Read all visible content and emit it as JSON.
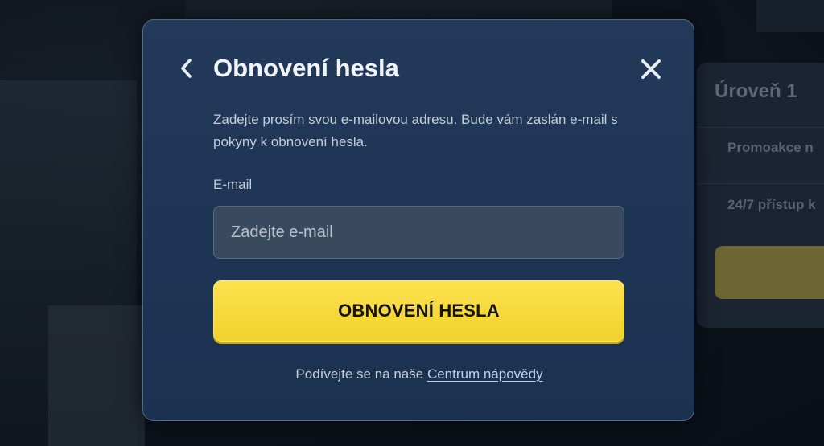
{
  "modal": {
    "title": "Obnovení hesla",
    "description": "Zadejte prosím svou e-mailovou adresu. Bude vám zaslán e-mail s pokyny k obnovení hesla.",
    "email_label": "E-mail",
    "email_placeholder": "Zadejte e-mail",
    "email_value": "",
    "submit_label": "OBNOVENÍ HESLA",
    "help_prefix": "Podívejte se na naše",
    "help_link": "Centrum nápovědy",
    "back_icon": "chevron-left-icon",
    "close_icon": "close-icon"
  },
  "background_card": {
    "title": "Úroveň 1",
    "items": [
      "Promoakce n",
      "24/7 přístup k"
    ]
  },
  "colors": {
    "modal_bg": "#1f3555",
    "button_yellow": "#f5d630",
    "link": "#b9d1f0"
  }
}
